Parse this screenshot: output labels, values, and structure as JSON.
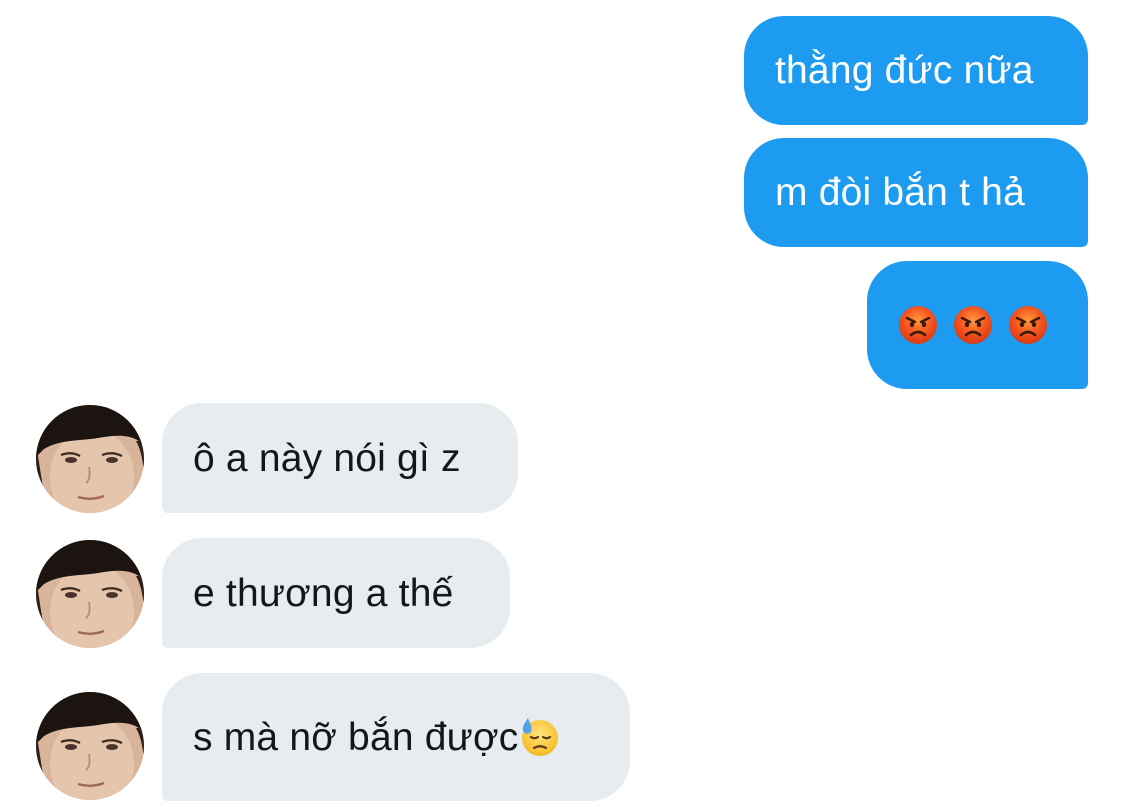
{
  "messages": [
    {
      "direction": "outgoing",
      "text": "thằng đức nữa"
    },
    {
      "direction": "outgoing",
      "text": "m đòi bắn t hả"
    },
    {
      "direction": "outgoing",
      "emojis": [
        "angry-face-icon",
        "angry-face-icon",
        "angry-face-icon"
      ]
    },
    {
      "direction": "incoming",
      "text": "ô a này nói gì z"
    },
    {
      "direction": "incoming",
      "text": "e thương a thế"
    },
    {
      "direction": "incoming",
      "text": "s mà nỡ bắn được",
      "trailing_emoji": "downcast-sweat-face-icon"
    }
  ],
  "colors": {
    "outgoing_bubble": "#1d9bf0",
    "incoming_bubble": "#e6ecf0",
    "outgoing_text": "#ffffff",
    "incoming_text": "#14171a"
  }
}
